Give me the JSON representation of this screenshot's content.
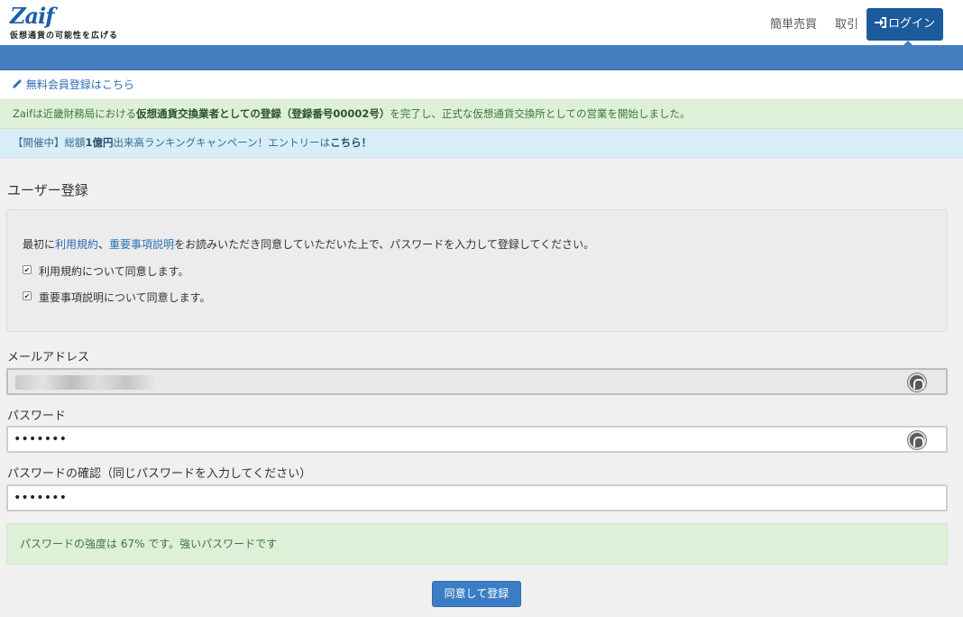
{
  "brand": {
    "logo_text": "Zaif",
    "tagline": "仮想通貨の可能性を広げる"
  },
  "nav": {
    "simple_trade": "簡単売買",
    "trade": "取引",
    "login": "ログイン",
    "login_icon": "sign-in-icon"
  },
  "signup_link": "無料会員登録はこちら",
  "alerts": {
    "green": {
      "text_before": "Zaifは近畿財務局における",
      "text_bold": "仮想通貨交換業者としての登録（登録番号00002号）",
      "text_after": "を完了し、正式な仮想通貨交換所としての営業を開始しました。"
    },
    "blue": {
      "prefix": "【開催中】総額",
      "amount": "1億円",
      "middle": "出来高ランキングキャンペーン！エントリーは",
      "link": "こちら！"
    }
  },
  "page_title": "ユーザー登録",
  "terms": {
    "intro_first": "最初に",
    "terms_link": "利用規約",
    "separator": "、",
    "important_link": "重要事項説明",
    "intro_rest": "をお読みいただき同意していただいた上で、パスワードを入力して登録してください。",
    "checkboxes": [
      {
        "label": "利用規約について同意します。",
        "checked": true
      },
      {
        "label": "重要事項説明について同意します。",
        "checked": true
      }
    ]
  },
  "form": {
    "email_label": "メールアドレス",
    "password_label": "パスワード",
    "password_value": "•••••••",
    "confirm_label": "パスワードの確認（同じパスワードを入力してください）",
    "confirm_value": "•••••••"
  },
  "strength_message": "パスワードの強度は 67% です。強いパスワードです",
  "submit_label": "同意して登録",
  "colors": {
    "brand_blue": "#1c5a9e",
    "header_bar": "#447ec0",
    "success_bg": "#dff0d8",
    "info_bg": "#d9edf7"
  }
}
